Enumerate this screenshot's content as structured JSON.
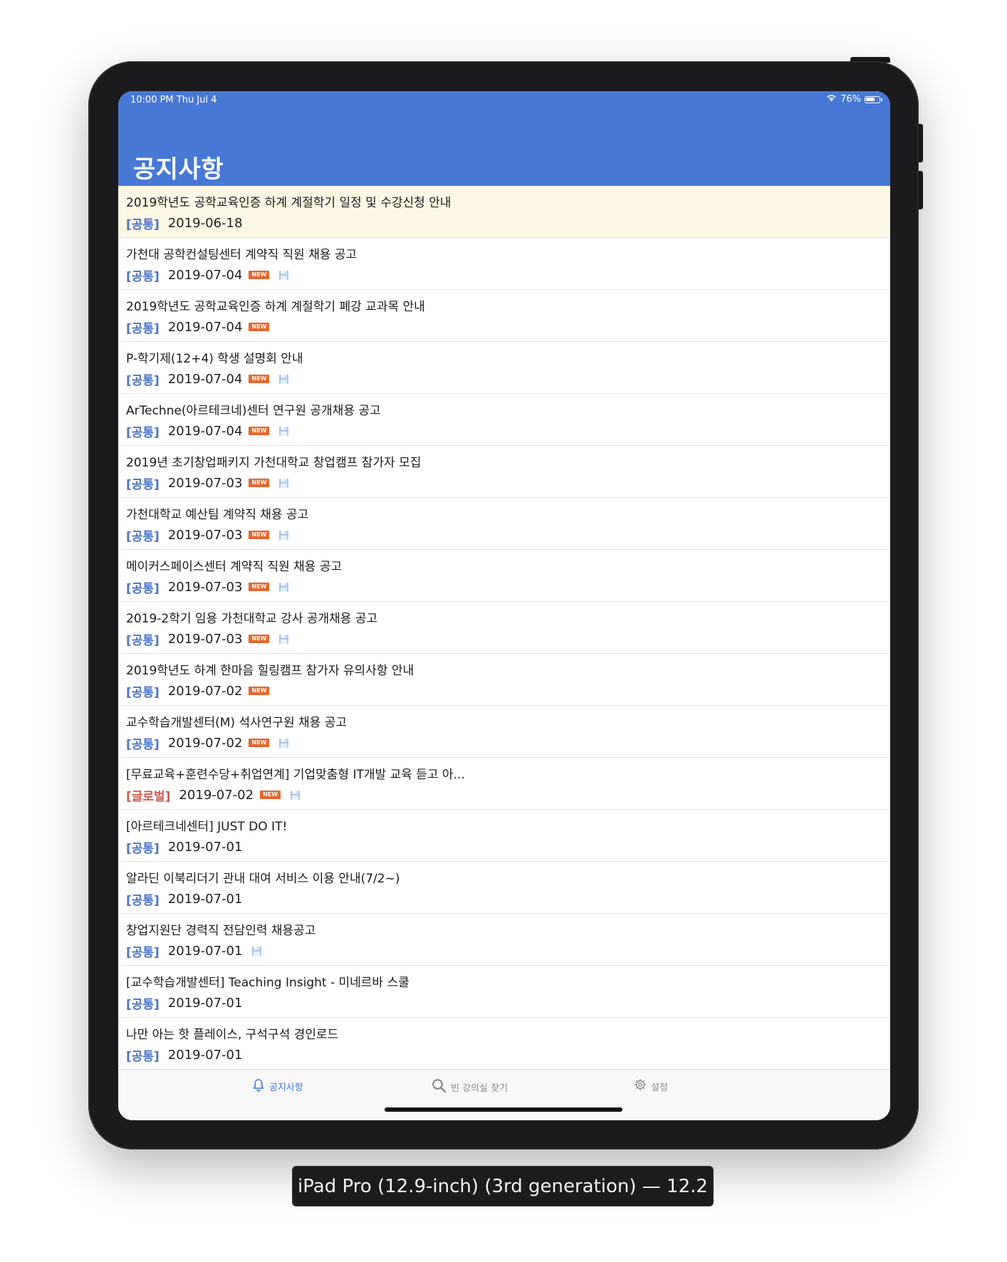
{
  "status_bar": {
    "time": "10:00 PM   Thu Jul 4",
    "battery": "76%",
    "battery_level": 0.76
  },
  "header": {
    "title": "공지사항"
  },
  "notices": [
    {
      "title": "2019학년도 공학교육인증 하계 계절학기 일정 및 수강신청 안내",
      "category": "[공통]",
      "date": "2019-06-18",
      "new": false,
      "attachment": false,
      "highlighted": true
    },
    {
      "title": "가천대 공학컨설팅센터 계약직 직원 채용 공고",
      "category": "[공통]",
      "date": "2019-07-04",
      "new": true,
      "attachment": true
    },
    {
      "title": "2019학년도 공학교육인증 하계 계절학기 폐강 교과목 안내",
      "category": "[공통]",
      "date": "2019-07-04",
      "new": true,
      "attachment": false
    },
    {
      "title": "P-학기제(12+4) 학생 설명회 안내",
      "category": "[공통]",
      "date": "2019-07-04",
      "new": true,
      "attachment": true
    },
    {
      "title": "ArTechne(아르테크네)센터 연구원 공개채용 공고",
      "category": "[공통]",
      "date": "2019-07-04",
      "new": true,
      "attachment": true
    },
    {
      "title": "2019년 초기창업패키지 가천대학교 창업캠프 참가자 모집",
      "category": "[공통]",
      "date": "2019-07-03",
      "new": true,
      "attachment": true
    },
    {
      "title": "가천대학교 예산팀 계약직 채용 공고",
      "category": "[공통]",
      "date": "2019-07-03",
      "new": true,
      "attachment": true
    },
    {
      "title": "메이커스페이스센터 계약직 직원 채용 공고",
      "category": "[공통]",
      "date": "2019-07-03",
      "new": true,
      "attachment": true
    },
    {
      "title": "2019-2학기 임용 가천대학교 강사 공개채용 공고",
      "category": "[공통]",
      "date": "2019-07-03",
      "new": true,
      "attachment": true
    },
    {
      "title": "2019학년도 하계 한마음 힐링캠프 참가자 유의사항 안내",
      "category": "[공통]",
      "date": "2019-07-02",
      "new": true,
      "attachment": false
    },
    {
      "title": "교수학습개발센터(M) 석사연구원 채용 공고",
      "category": "[공통]",
      "date": "2019-07-02",
      "new": true,
      "attachment": true
    },
    {
      "title": "[무료교육+훈련수당+취업연계] 기업맞춤형 IT개발 교육 듣고 아...",
      "category": "[글로벌]",
      "date": "2019-07-02",
      "new": true,
      "attachment": true,
      "global": true
    },
    {
      "title": "[아르테크네센터] JUST DO IT!",
      "category": "[공통]",
      "date": "2019-07-01",
      "new": false,
      "attachment": false
    },
    {
      "title": "알라딘 이북리더기 관내 대여 서비스 이용 안내(7/2~)",
      "category": "[공통]",
      "date": "2019-07-01",
      "new": false,
      "attachment": false
    },
    {
      "title": "창업지원단 경력직 전담인력 채용공고",
      "category": "[공통]",
      "date": "2019-07-01",
      "new": false,
      "attachment": true
    },
    {
      "title": "[교수학습개발센터] Teaching Insight - 미네르바 스쿨",
      "category": "[공통]",
      "date": "2019-07-01",
      "new": false,
      "attachment": false
    },
    {
      "title": "나만 아는 핫 플레이스, 구석구석 경인로드",
      "category": "[공통]",
      "date": "2019-07-01",
      "new": false,
      "attachment": false
    }
  ],
  "new_badge_label": "NEW",
  "tabbar": {
    "tabs": [
      {
        "label": "공지사항",
        "icon": "bell-icon",
        "active": true
      },
      {
        "label": "빈 강의실 찾기",
        "icon": "search-icon",
        "active": false
      },
      {
        "label": "설정",
        "icon": "gear-icon",
        "active": false
      }
    ]
  },
  "device_label": "iPad Pro (12.9-inch) (3rd generation) — 12.2",
  "colors": {
    "header": "#4878d5",
    "highlight_row": "#fcf6e4",
    "category_common": "#4a74c9",
    "category_global": "#d35a4e",
    "new_badge": "#e4662e",
    "tab_active": "#3a78e8"
  }
}
